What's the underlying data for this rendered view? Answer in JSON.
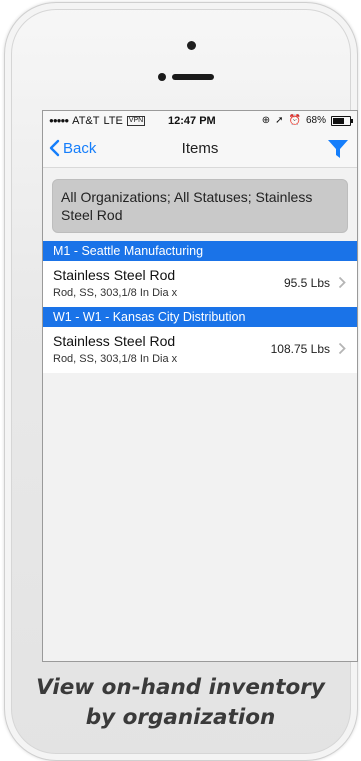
{
  "status_bar": {
    "carrier": "AT&T",
    "network": "LTE",
    "vpn": "VPN",
    "time": "12:47 PM",
    "battery": "68%",
    "battery_level": 0.68
  },
  "navbar": {
    "back_label": "Back",
    "title": "Items"
  },
  "filter_summary": "All Organizations; All Statuses; Stainless Steel Rod",
  "groups": [
    {
      "header": "M1 - Seattle Manufacturing",
      "item": {
        "name": "Stainless Steel Rod",
        "description": "Rod, SS, 303,1/8 In Dia x",
        "quantity": "95.5 Lbs"
      }
    },
    {
      "header": "W1 - W1 - Kansas City Distribution",
      "item": {
        "name": "Stainless Steel Rod",
        "description": "Rod, SS, 303,1/8 In Dia x",
        "quantity": "108.75 Lbs"
      }
    }
  ],
  "caption": {
    "line1": "View on-hand inventory",
    "line2": "by organization"
  },
  "colors": {
    "accent": "#157efb",
    "group_header": "#1a73e8",
    "summary_bg": "#c9c9c9"
  }
}
